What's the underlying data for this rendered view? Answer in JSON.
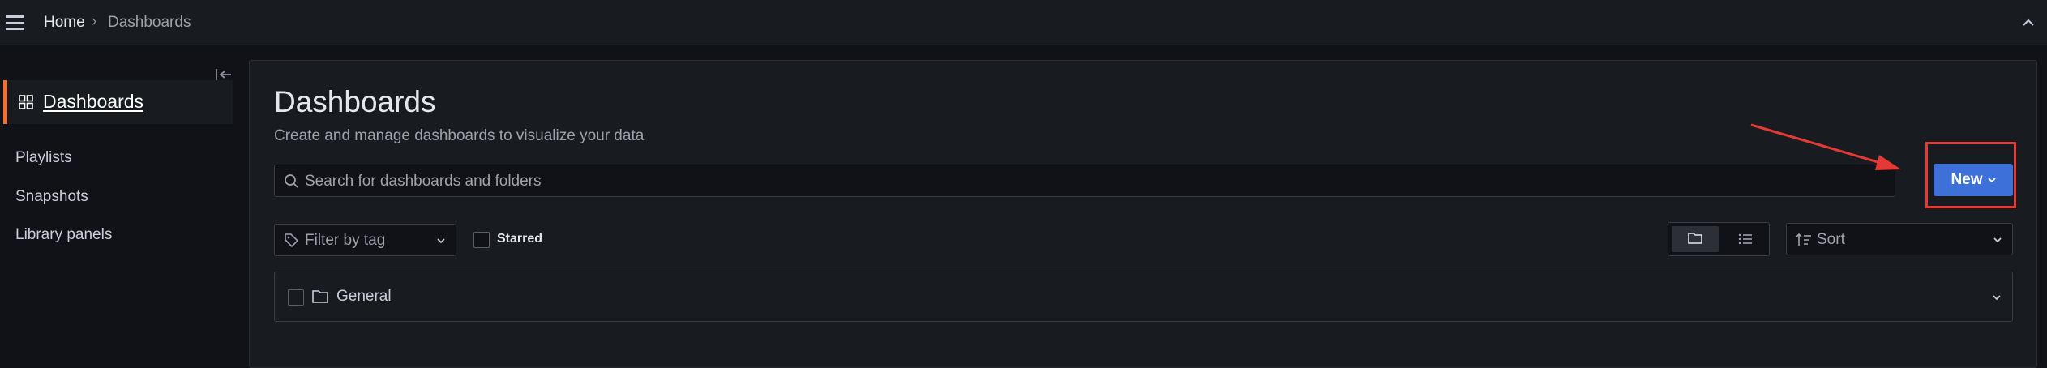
{
  "header": {
    "breadcrumb_home": "Home",
    "breadcrumb_separator": "›",
    "breadcrumb_current": "Dashboards"
  },
  "sidebar": {
    "active_item": "Dashboards",
    "items": [
      {
        "label": "Playlists"
      },
      {
        "label": "Snapshots"
      },
      {
        "label": "Library panels"
      }
    ]
  },
  "main": {
    "title": "Dashboards",
    "subtitle": "Create and manage dashboards to visualize your data",
    "search_placeholder": "Search for dashboards and folders",
    "new_button_label": "New",
    "filter_tag_label": "Filter by tag",
    "starred_label": "Starred",
    "sort_label": "Sort",
    "folders": [
      {
        "name": "General"
      }
    ]
  },
  "colors": {
    "background": "#111217",
    "panel": "#181b1f",
    "primary_button": "#3d71d9",
    "active_accent": "#f46f2e",
    "annotation_red": "#e53935"
  },
  "icons": {
    "menu": "hamburger-icon",
    "dashboards": "grid-icon",
    "search": "search-icon",
    "tag": "tag-icon",
    "folder_view": "folder-icon",
    "list_view": "list-icon",
    "sort": "sort-icon"
  }
}
